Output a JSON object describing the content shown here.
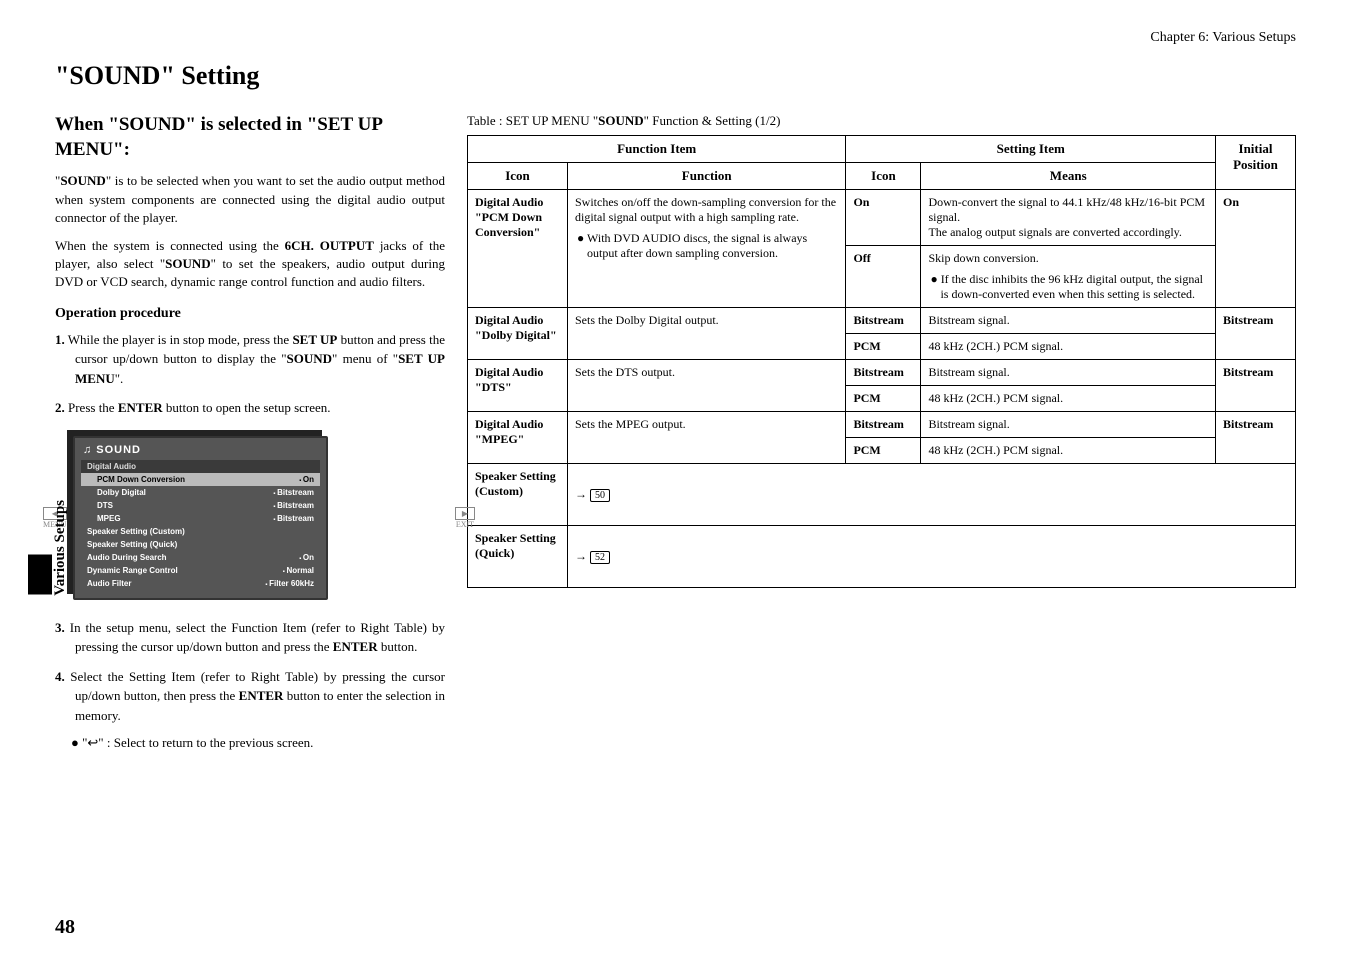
{
  "chapter": "Chapter 6: Various Setups",
  "main_title": "\"SOUND\" Setting",
  "section_title": "When \"SOUND\" is selected in \"SET UP MENU\":",
  "intro1_pre": "\"",
  "intro1_bold1": "SOUND",
  "intro1_post": "\" is to be selected when you want to set the audio output method when system components are connected using the digital audio output connector of the player.",
  "intro2_pre": "When the system is connected using the ",
  "intro2_b1": "6CH. OUTPUT",
  "intro2_mid1": " jacks of the player, also select \"",
  "intro2_b2": "SOUND",
  "intro2_post": "\" to set the speakers, audio output during DVD or VCD search, dynamic range control function and audio filters.",
  "op_heading": "Operation procedure",
  "step1_num": "1.",
  "step1_a": " While the player is in stop mode, press the  ",
  "step1_b1": "SET UP",
  "step1_b": " button and press the cursor up/down button to display the \"",
  "step1_b2": "SOUND",
  "step1_c": "\" menu of \"",
  "step1_b3": "SET UP MENU",
  "step1_d": "\".",
  "step2_num": "2.",
  "step2_a": " Press the ",
  "step2_b1": "ENTER",
  "step2_b": " button to open the setup screen.",
  "step3_num": "3.",
  "step3_a": " In the setup menu, select the Function Item (refer to Right Table) by pressing the cursor up/down button and press the ",
  "step3_b1": "ENTER",
  "step3_b": " button.",
  "step4_num": "4.",
  "step4_a": " Select the Setting Item (refer to Right Table) by pressing the cursor up/down button, then press the ",
  "step4_b1": "ENTER",
  "step4_b": " button to enter the selection in memory.",
  "bullet_return": "\"↩\"  :  Select to return to the previous screen.",
  "osd": {
    "title": "SOUND",
    "section_da": "Digital Audio",
    "rows": [
      {
        "label": "PCM Down Conversion",
        "val": "On"
      },
      {
        "label": "Dolby Digital",
        "val": "Bitstream"
      },
      {
        "label": "DTS",
        "val": "Bitstream"
      },
      {
        "label": "MPEG",
        "val": "Bitstream"
      }
    ],
    "rows2": [
      {
        "label": "Speaker Setting (Custom)",
        "val": ""
      },
      {
        "label": "Speaker Setting (Quick)",
        "val": ""
      },
      {
        "label": "Audio  During Search",
        "val": "On"
      },
      {
        "label": "Dynamic Range Control",
        "val": "Normal"
      },
      {
        "label": "Audio  Filter",
        "val": "Filter 60kHz"
      }
    ],
    "menu_label": "MENU",
    "exit_label": "EXIT"
  },
  "side_text": "Various Setups",
  "page_num": "48",
  "table_caption_pre": "Table : SET UP MENU \"",
  "table_caption_b": "SOUND",
  "table_caption_post": "\" Function & Setting (1/2)",
  "th_function_item": "Function Item",
  "th_setting_item": "Setting Item",
  "th_initial_position": "Initial Position",
  "th_icon": "Icon",
  "th_function": "Function",
  "th_means": "Means",
  "rows": {
    "pcm": {
      "icon": "Digital Audio \"PCM Down Conversion\"",
      "fn1": "Switches on/off the down-sampling conversion for the digital signal output with a high sampling rate.",
      "fn2": "With DVD AUDIO discs, the signal is always output after down sampling conversion.",
      "on_label": "On",
      "on_means": "Down-convert the signal to 44.1 kHz/48 kHz/16-bit PCM signal.\nThe analog output signals are converted accordingly.",
      "off_label": "Off",
      "off_means1": "Skip down conversion.",
      "off_means2": "If the disc inhibits the 96 kHz digital output, the signal is down-converted even when this setting is selected.",
      "initial": "On"
    },
    "dolby": {
      "icon": "Digital Audio \"Dolby Digital\"",
      "fn": "Sets the Dolby Digital output.",
      "bs_label": "Bitstream",
      "bs_means": "Bitstream signal.",
      "pcm_label": "PCM",
      "pcm_means": "48 kHz (2CH.) PCM signal.",
      "initial": "Bitstream"
    },
    "dts": {
      "icon": "Digital Audio \"DTS\"",
      "fn": "Sets the DTS output.",
      "bs_label": "Bitstream",
      "bs_means": "Bitstream signal.",
      "pcm_label": "PCM",
      "pcm_means": "48 kHz (2CH.) PCM signal.",
      "initial": "Bitstream"
    },
    "mpeg": {
      "icon": "Digital Audio \"MPEG\"",
      "fn": "Sets the MPEG output.",
      "bs_label": "Bitstream",
      "bs_means": "Bitstream signal.",
      "pcm_label": "PCM",
      "pcm_means": "48 kHz (2CH.) PCM signal.",
      "initial": "Bitstream"
    },
    "sp_custom": {
      "icon": "Speaker Setting (Custom)",
      "ref": "50"
    },
    "sp_quick": {
      "icon": "Speaker Setting (Quick)",
      "ref": "52"
    }
  }
}
